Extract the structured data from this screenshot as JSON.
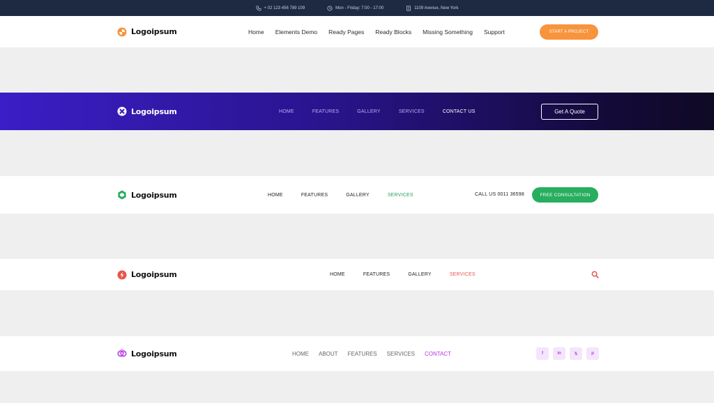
{
  "topbar": {
    "phone": "+ 02 123 456 789 109",
    "hours": "Mon - Friday: 7:00 - 17:00",
    "address": "1109 Avenue, New York"
  },
  "header1": {
    "logo": "Logoipsum",
    "nav": [
      "Home",
      "Elements Demo",
      "Ready Pages",
      "Ready Blocks",
      "Missing Something",
      "Support"
    ],
    "cta": "START A PROJECT",
    "accent": "#f7943c"
  },
  "header2": {
    "logo": "Logoipsum",
    "nav": [
      "HOME",
      "FEATURES",
      "GALLERY",
      "SERVICES",
      "CONTACT US"
    ],
    "cta": "Get A Quote",
    "accent": "#3b1ec6"
  },
  "header3": {
    "logo": "Logoipsum",
    "nav": [
      "HOME",
      "FEATURES",
      "GALLERY",
      "SERVICES"
    ],
    "call": "CALL US 0011 36598",
    "cta": "FREE CONSULTATION",
    "accent": "#27ae5e"
  },
  "header4": {
    "logo": "Logoipsum",
    "nav": [
      "HOME",
      "FEATURES",
      "GALLERY",
      "SERVICES"
    ],
    "accent": "#e8544c",
    "icon": "search-icon"
  },
  "header5": {
    "logo": "Logoipsum",
    "nav": [
      "HOME",
      "ABOUT",
      "FEATURES",
      "SERVICES",
      "CONTACT"
    ],
    "socials": [
      "f",
      "in",
      "𝕏",
      "p"
    ],
    "accent": "#b437e4"
  }
}
